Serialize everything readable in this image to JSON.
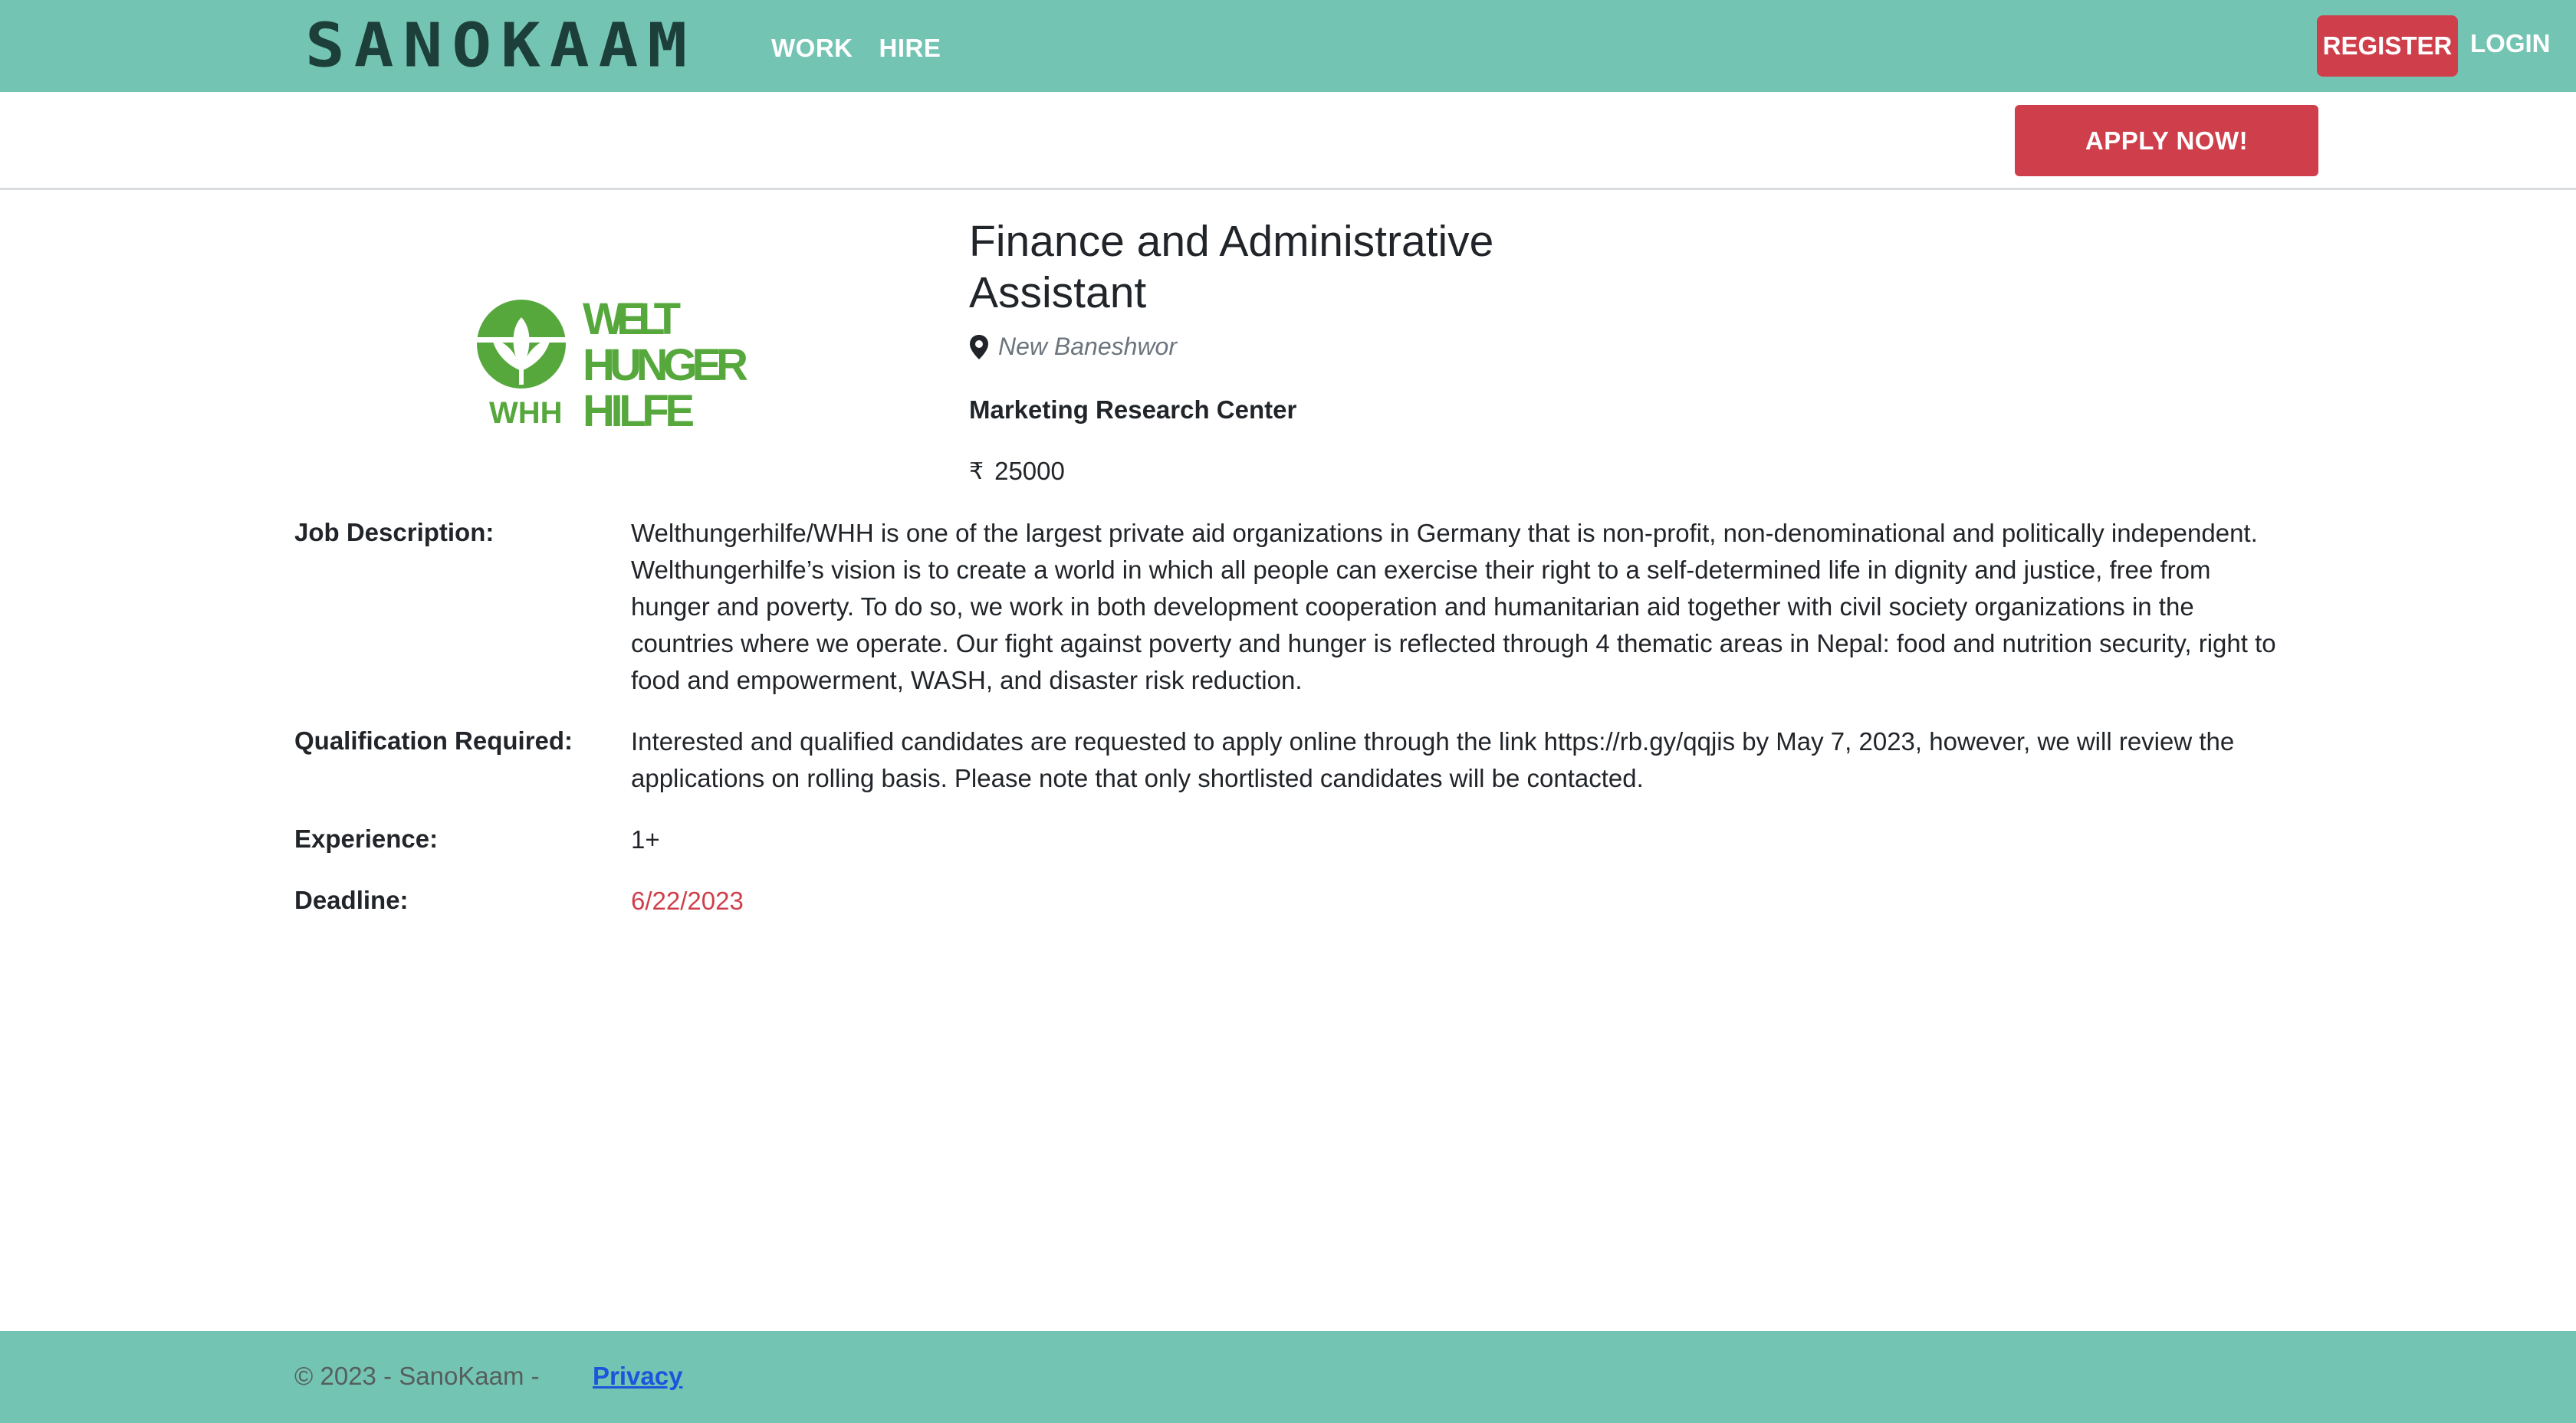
{
  "header": {
    "brand": "SANOKAAM",
    "nav": [
      {
        "label": "WORK"
      },
      {
        "label": "HIRE"
      }
    ],
    "register_label": "REGISTER",
    "login_label": "LOGIN"
  },
  "subbar": {
    "apply_label": "APPLY NOW!"
  },
  "logo": {
    "lines": [
      "WELT",
      "HUNGER",
      "HILFE"
    ],
    "abbr": "WHH",
    "color": "#56a83c"
  },
  "job": {
    "title": "Finance and Administrative Assistant",
    "location": "New Baneshwor",
    "company": "Marketing Research Center",
    "currency_symbol": "₹",
    "salary": "25000"
  },
  "details": {
    "description_label": "Job Description:",
    "description": "Welthungerhilfe/WHH is one of the largest private aid organizations in Germany that is non-profit, non-denominational and politically independent. Welthungerhilfe’s vision is to create a world in which all people can exercise their right to a self-determined life in dignity and justice, free from hunger and poverty. To do so, we work in both development cooperation and humanitarian aid together with civil society organizations in the countries where we operate. Our fight against poverty and hunger is reflected through 4 thematic areas in Nepal: food and nutrition security, right to food and empowerment, WASH, and disaster risk reduction.",
    "qualification_label": "Qualification Required:",
    "qualification": "Interested and qualified candidates are requested to apply online through the link https://rb.gy/qqjis by May 7, 2023, however, we will review the applications on rolling basis. Please note that only shortlisted candidates will be contacted.",
    "experience_label": "Experience:",
    "experience": "1+",
    "deadline_label": "Deadline:",
    "deadline": "6/22/2023"
  },
  "footer": {
    "copyright": "© 2023 - SanoKaam -",
    "privacy_label": "Privacy"
  },
  "colors": {
    "header_bg": "#74c4b4",
    "accent_red": "#cf3f4b",
    "brand_dark": "#1d3f3a"
  }
}
